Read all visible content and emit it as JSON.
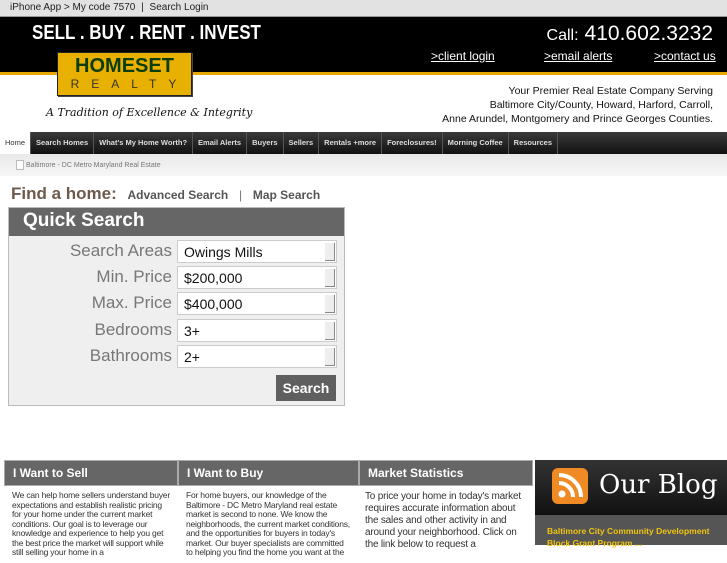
{
  "topbar": {
    "iphone": "iPhone App > My code 7570",
    "sep": "|",
    "login": "Search Login"
  },
  "header": {
    "slogan": "SELL . BUY . RENT . INVEST",
    "call_label": "Call:",
    "phone": "410.602.3232",
    "links": [
      ">client login",
      ">email alerts",
      ">contact us"
    ]
  },
  "logo": {
    "line1": "HOMESET",
    "line2": "REALTY",
    "tagline": "A Tradition of Excellence & Integrity"
  },
  "serving": [
    "Your Premier Real Estate Company Serving",
    "Baltimore City/County, Howard, Harford, Carroll,",
    "Anne Arundel, Montgomery and Prince Georges Counties."
  ],
  "nav": [
    "Home",
    "Search Homes",
    "What's My Home Worth?",
    "Email Alerts",
    "Buyers",
    "Sellers",
    "Rentals +more",
    "Foreclosures!",
    "Morning Coffee",
    "Resources"
  ],
  "breadcrumb": "Baltimore - DC Metro Maryland Real Estate",
  "find": {
    "title": "Find a home:",
    "advanced": "Advanced Search",
    "sep": "|",
    "map": "Map Search"
  },
  "quick_search": {
    "title": "Quick Search",
    "fields": [
      {
        "label": "Search Areas",
        "value": "Owings Mills"
      },
      {
        "label": "Min. Price",
        "value": "$200,000"
      },
      {
        "label": "Max. Price",
        "value": "$400,000"
      },
      {
        "label": "Bedrooms",
        "value": "3+"
      },
      {
        "label": "Bathrooms",
        "value": "2+"
      }
    ],
    "button": "Search"
  },
  "columns": [
    {
      "title": "I Want to Sell",
      "text": "We can help home sellers understand buyer expectations and establish realistic pricing for your home under the current market conditions. Our goal is to leverage our knowledge and experience to help you get the best price the market will support while still selling your home in a"
    },
    {
      "title": "I Want to Buy",
      "text": "For home buyers, our knowledge of the Baltimore - DC Metro Maryland real estate market is second to none. We know the neighborhoods, the current market conditions, and the opportunities for buyers in today's market. Our buyer specialists are committed to helping you find the home you want at the"
    },
    {
      "title": "Market Statistics",
      "text": "To price your home in today's market requires accurate information about the sales and other activity in and around your neighborhood. Click on the link below to request a"
    }
  ],
  "blog": {
    "title": "Our Blog",
    "post": "Baltimore City Community Development Block Grant Program ..."
  },
  "colors": {
    "accent": "#e8b000",
    "header": "#000000",
    "panel": "#666666",
    "blog_link": "#f1c40f"
  }
}
